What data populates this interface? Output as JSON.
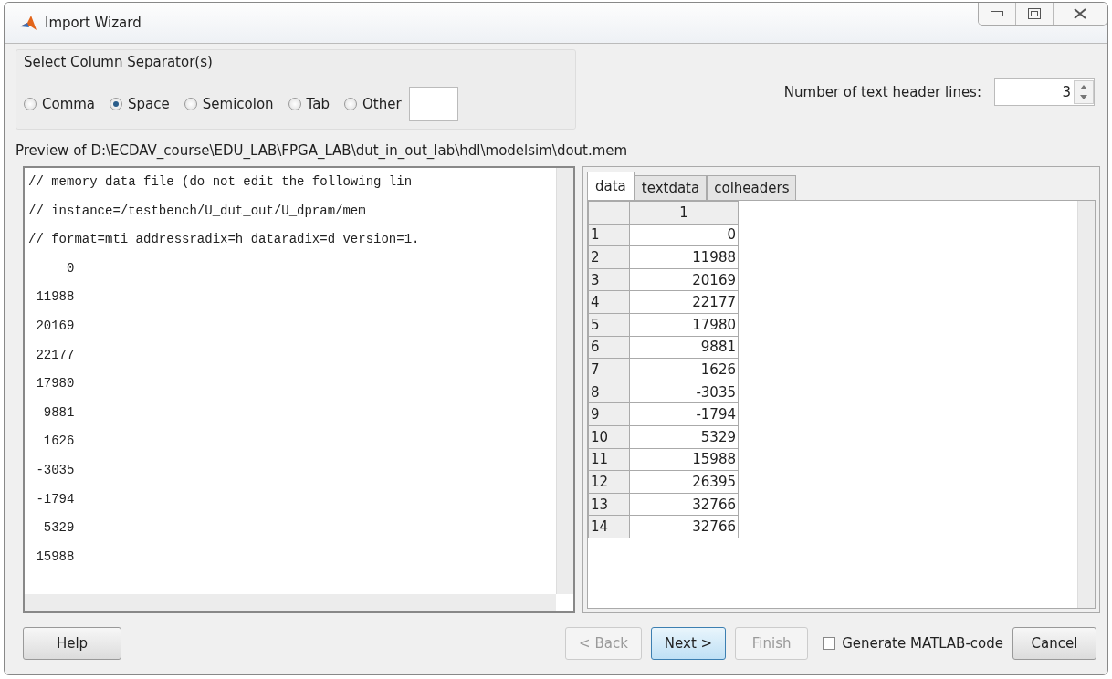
{
  "window": {
    "title": "Import Wizard"
  },
  "separator_group": {
    "title": "Select Column Separator(s)",
    "options": [
      {
        "label": "Comma",
        "selected": false
      },
      {
        "label": "Space",
        "selected": true
      },
      {
        "label": "Semicolon",
        "selected": false
      },
      {
        "label": "Tab",
        "selected": false
      },
      {
        "label": "Other",
        "selected": false
      }
    ]
  },
  "header_lines": {
    "label": "Number of text header lines:",
    "value": "3"
  },
  "preview_label": "Preview of D:\\ECDAV_course\\EDU_LAB\\FPGA_LAB\\dut_in_out_lab\\hdl\\modelsim\\dout.mem",
  "text_preview": [
    "// memory data file (do not edit the following lin",
    "// instance=/testbench/U_dut_out/U_dpram/mem",
    "// format=mti addressradix=h dataradix=d version=1.",
    "     0",
    " 11988",
    " 20169",
    " 22177",
    " 17980",
    "  9881",
    "  1626",
    " -3035",
    " -1794",
    "  5329",
    " 15988"
  ],
  "tabs": [
    {
      "label": "data",
      "selected": true
    },
    {
      "label": "textdata",
      "selected": false
    },
    {
      "label": "colheaders",
      "selected": false
    }
  ],
  "table": {
    "columns": [
      "1"
    ],
    "rows": [
      {
        "index": "1",
        "value": "0"
      },
      {
        "index": "2",
        "value": "11988"
      },
      {
        "index": "3",
        "value": "20169"
      },
      {
        "index": "4",
        "value": "22177"
      },
      {
        "index": "5",
        "value": "17980"
      },
      {
        "index": "6",
        "value": "9881"
      },
      {
        "index": "7",
        "value": "1626"
      },
      {
        "index": "8",
        "value": "-3035"
      },
      {
        "index": "9",
        "value": "-1794"
      },
      {
        "index": "10",
        "value": "5329"
      },
      {
        "index": "11",
        "value": "15988"
      },
      {
        "index": "12",
        "value": "26395"
      },
      {
        "index": "13",
        "value": "32766"
      },
      {
        "index": "14",
        "value": "32766"
      }
    ]
  },
  "help_button": {
    "label": "Help"
  },
  "nav_buttons": [
    {
      "label": "< Back",
      "disabled": true,
      "default": false
    },
    {
      "label": "Next >",
      "disabled": false,
      "default": true
    },
    {
      "label": "Finish",
      "disabled": true,
      "default": false
    }
  ],
  "generate_code": {
    "label": "Generate MATLAB-code",
    "checked": false
  },
  "cancel_button": {
    "label": "Cancel"
  }
}
